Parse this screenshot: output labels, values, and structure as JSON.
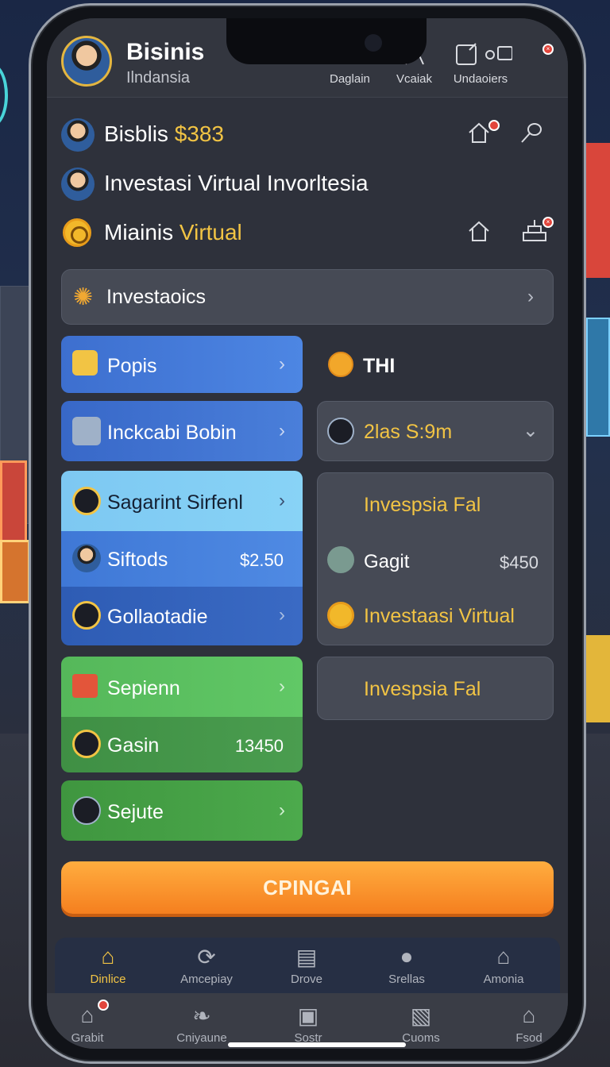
{
  "header": {
    "title": "Bisinis",
    "subtitle": "Ilndansia",
    "nav": [
      {
        "label": "Daglain",
        "icon": "chevron-icon"
      },
      {
        "label": "Vcaiak",
        "icon": "triangle-icon"
      },
      {
        "label": "Undaoiers",
        "icon": "edit-icon"
      }
    ]
  },
  "info": {
    "row1_name": "Bisblis",
    "row1_amount": "$383",
    "row2_text": "Investasi Virtual Invorltesia",
    "row3_prefix": "Miainis",
    "row3_highlight": "Virtual"
  },
  "invest_bar": {
    "label": "Investaoics"
  },
  "left_cards": {
    "popis": "Popis",
    "inckcabi": "Inckcabi Bobin",
    "sagarint": "Sagarint Sirfenl",
    "siftods": "Siftods",
    "siftods_value": "$2.50",
    "gollaotadie": "Gollaotadie",
    "sepienn": "Sepienn",
    "gasin": "Gasin",
    "gasin_value": "13450",
    "sejute": "Sejute"
  },
  "right_cards": {
    "thi_label": "THI",
    "dropdown_value": "2las S:9m",
    "invespsia_1": "Invespsia Fal",
    "gagit": "Gagit",
    "gagit_value": "$450",
    "investaasi": "Investaasi Virtual",
    "invespsia_2": "Invespsia Fal"
  },
  "cta": {
    "label": "CPINGAI"
  },
  "bottom_nav_primary": [
    {
      "label": "Dinlice",
      "icon": "home-icon",
      "active": true
    },
    {
      "label": "Amcepiay",
      "icon": "refresh-icon"
    },
    {
      "label": "Drove",
      "icon": "document-icon"
    },
    {
      "label": "Srellas",
      "icon": "user-icon"
    },
    {
      "label": "Amonia",
      "icon": "house-icon"
    }
  ],
  "bottom_nav_secondary": [
    {
      "label": "Grabit",
      "icon": "house-icon"
    },
    {
      "label": "Cniyaune",
      "icon": "leaf-icon"
    },
    {
      "label": "Sostr",
      "icon": "bag-icon"
    },
    {
      "label": "Cuoms",
      "icon": "image-icon"
    },
    {
      "label": "Fsod",
      "icon": "building-icon"
    }
  ],
  "colors": {
    "accent": "#f2c444",
    "cta": "#f8942c",
    "panel": "#464a55",
    "screen_bg": "#2e313b"
  }
}
